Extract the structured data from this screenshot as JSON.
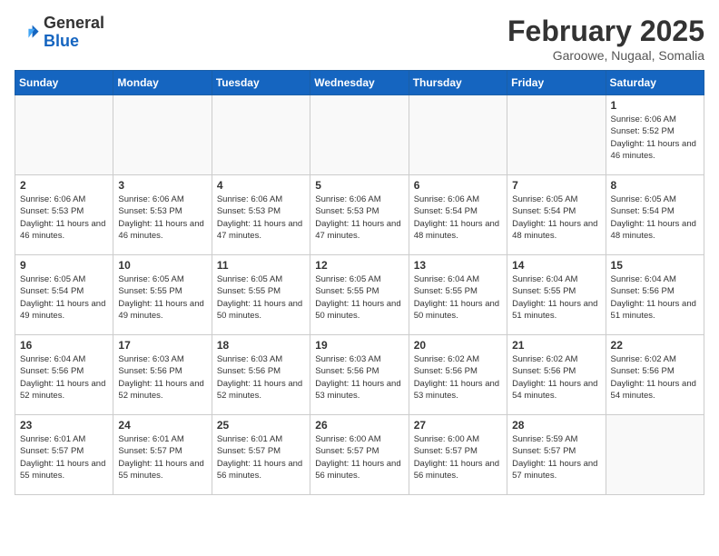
{
  "header": {
    "logo": {
      "general": "General",
      "blue": "Blue"
    },
    "month_year": "February 2025",
    "location": "Garoowe, Nugaal, Somalia"
  },
  "weekdays": [
    "Sunday",
    "Monday",
    "Tuesday",
    "Wednesday",
    "Thursday",
    "Friday",
    "Saturday"
  ],
  "weeks": [
    [
      {
        "day": "",
        "empty": true
      },
      {
        "day": "",
        "empty": true
      },
      {
        "day": "",
        "empty": true
      },
      {
        "day": "",
        "empty": true
      },
      {
        "day": "",
        "empty": true
      },
      {
        "day": "",
        "empty": true
      },
      {
        "day": "1",
        "sunrise": "6:06 AM",
        "sunset": "5:52 PM",
        "daylight": "11 hours and 46 minutes."
      }
    ],
    [
      {
        "day": "2",
        "sunrise": "6:06 AM",
        "sunset": "5:53 PM",
        "daylight": "11 hours and 46 minutes."
      },
      {
        "day": "3",
        "sunrise": "6:06 AM",
        "sunset": "5:53 PM",
        "daylight": "11 hours and 46 minutes."
      },
      {
        "day": "4",
        "sunrise": "6:06 AM",
        "sunset": "5:53 PM",
        "daylight": "11 hours and 47 minutes."
      },
      {
        "day": "5",
        "sunrise": "6:06 AM",
        "sunset": "5:53 PM",
        "daylight": "11 hours and 47 minutes."
      },
      {
        "day": "6",
        "sunrise": "6:06 AM",
        "sunset": "5:54 PM",
        "daylight": "11 hours and 48 minutes."
      },
      {
        "day": "7",
        "sunrise": "6:05 AM",
        "sunset": "5:54 PM",
        "daylight": "11 hours and 48 minutes."
      },
      {
        "day": "8",
        "sunrise": "6:05 AM",
        "sunset": "5:54 PM",
        "daylight": "11 hours and 48 minutes."
      }
    ],
    [
      {
        "day": "9",
        "sunrise": "6:05 AM",
        "sunset": "5:54 PM",
        "daylight": "11 hours and 49 minutes."
      },
      {
        "day": "10",
        "sunrise": "6:05 AM",
        "sunset": "5:55 PM",
        "daylight": "11 hours and 49 minutes."
      },
      {
        "day": "11",
        "sunrise": "6:05 AM",
        "sunset": "5:55 PM",
        "daylight": "11 hours and 50 minutes."
      },
      {
        "day": "12",
        "sunrise": "6:05 AM",
        "sunset": "5:55 PM",
        "daylight": "11 hours and 50 minutes."
      },
      {
        "day": "13",
        "sunrise": "6:04 AM",
        "sunset": "5:55 PM",
        "daylight": "11 hours and 50 minutes."
      },
      {
        "day": "14",
        "sunrise": "6:04 AM",
        "sunset": "5:55 PM",
        "daylight": "11 hours and 51 minutes."
      },
      {
        "day": "15",
        "sunrise": "6:04 AM",
        "sunset": "5:56 PM",
        "daylight": "11 hours and 51 minutes."
      }
    ],
    [
      {
        "day": "16",
        "sunrise": "6:04 AM",
        "sunset": "5:56 PM",
        "daylight": "11 hours and 52 minutes."
      },
      {
        "day": "17",
        "sunrise": "6:03 AM",
        "sunset": "5:56 PM",
        "daylight": "11 hours and 52 minutes."
      },
      {
        "day": "18",
        "sunrise": "6:03 AM",
        "sunset": "5:56 PM",
        "daylight": "11 hours and 52 minutes."
      },
      {
        "day": "19",
        "sunrise": "6:03 AM",
        "sunset": "5:56 PM",
        "daylight": "11 hours and 53 minutes."
      },
      {
        "day": "20",
        "sunrise": "6:02 AM",
        "sunset": "5:56 PM",
        "daylight": "11 hours and 53 minutes."
      },
      {
        "day": "21",
        "sunrise": "6:02 AM",
        "sunset": "5:56 PM",
        "daylight": "11 hours and 54 minutes."
      },
      {
        "day": "22",
        "sunrise": "6:02 AM",
        "sunset": "5:56 PM",
        "daylight": "11 hours and 54 minutes."
      }
    ],
    [
      {
        "day": "23",
        "sunrise": "6:01 AM",
        "sunset": "5:57 PM",
        "daylight": "11 hours and 55 minutes."
      },
      {
        "day": "24",
        "sunrise": "6:01 AM",
        "sunset": "5:57 PM",
        "daylight": "11 hours and 55 minutes."
      },
      {
        "day": "25",
        "sunrise": "6:01 AM",
        "sunset": "5:57 PM",
        "daylight": "11 hours and 56 minutes."
      },
      {
        "day": "26",
        "sunrise": "6:00 AM",
        "sunset": "5:57 PM",
        "daylight": "11 hours and 56 minutes."
      },
      {
        "day": "27",
        "sunrise": "6:00 AM",
        "sunset": "5:57 PM",
        "daylight": "11 hours and 56 minutes."
      },
      {
        "day": "28",
        "sunrise": "5:59 AM",
        "sunset": "5:57 PM",
        "daylight": "11 hours and 57 minutes."
      },
      {
        "day": "",
        "empty": true
      }
    ]
  ]
}
